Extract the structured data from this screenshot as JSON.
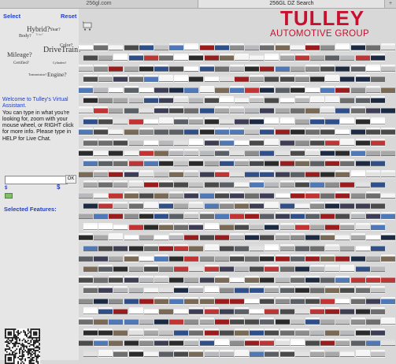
{
  "browser": {
    "tabs": [
      {
        "label": "256gl.com",
        "active": false
      },
      {
        "label": "256GL DZ Search",
        "active": true
      }
    ],
    "new_tab_label": "+"
  },
  "sidebar": {
    "select_label": "Select",
    "reset_label": "Reset",
    "word_cloud": [
      "Hybrid?",
      "Year?",
      "Body?",
      "Trim?",
      "Color?",
      "Mileage?",
      "DriveTrain?",
      "Certified?",
      "Cylinders?",
      "Transmission?",
      "Engine?"
    ],
    "assistant": {
      "title": "Welcome to Tulley's Virtual Assistant.",
      "body": "You can type in what you're looking for, zoom with your mouse wheel, or RIGHT click for more info. Please type in HELP for Live Chat."
    },
    "search": {
      "value": "",
      "ok_label": "OK"
    },
    "price": {
      "min_symbol": "$",
      "max_symbol": "$"
    },
    "selected_features_label": "Selected Features:"
  },
  "logo": {
    "wordmark": "TULLEY",
    "subtitle": "AUTOMOTIVE GROUP",
    "color": "#c8102e"
  },
  "colors": {
    "accent_blue": "#1f3fcf",
    "sidebar_bg": "#e6e6e6",
    "slider_green": "#7ec06a",
    "car_palette": [
      "#2b2b2b",
      "#4a4a4a",
      "#6e6e6e",
      "#8d8d8d",
      "#a8a8a8",
      "#c4c4c4",
      "#e2e2e2",
      "#f5f5f5",
      "#ffffff",
      "#1c2a44",
      "#2e4f8a",
      "#4f78b8",
      "#9b1c1c",
      "#c23333",
      "#3d3d55",
      "#5b5f66",
      "#b7b9bd",
      "#7a6a55"
    ]
  },
  "icons": {
    "cart": "shopping-cart-icon",
    "qr": "qr-code-icon"
  }
}
